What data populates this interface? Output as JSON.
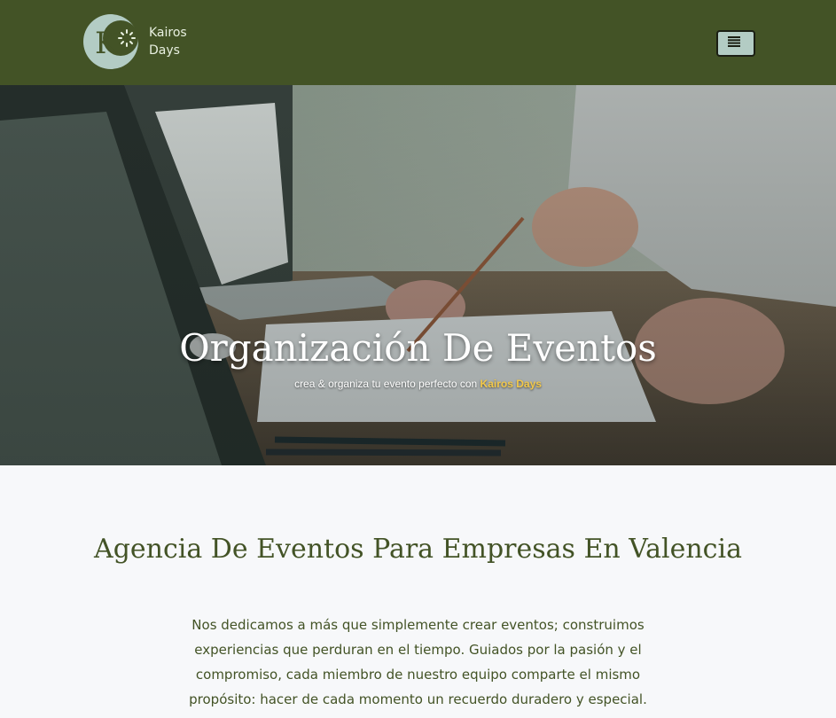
{
  "header": {
    "brand_line1": "Kairos",
    "brand_line2": "Days",
    "logo_letter": "K",
    "menu_icon": "hamburger-menu-icon",
    "colors": {
      "background": "#435326",
      "logo": "#b3ccc4"
    }
  },
  "hero": {
    "title": "Organización De Eventos",
    "subtitle_prefix": "crea & organiza tu evento perfecto con",
    "subtitle_brand": "Kairos Days",
    "colors": {
      "accent": "#f2c84a"
    }
  },
  "main": {
    "heading": "Agencia De Eventos Para Empresas En Valencia",
    "paragraph": "Nos dedicamos a más que simplemente crear eventos; construimos experiencias que perduran en el tiempo. Guiados por la pasión y el compromiso, cada miembro de nuestro equipo comparte el mismo propósito: hacer de cada momento un recuerdo duradero y especial.",
    "colors": {
      "text": "#435326"
    }
  }
}
